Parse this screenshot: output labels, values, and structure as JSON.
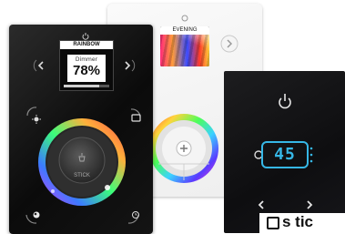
{
  "white_panel": {
    "screen": {
      "scene_label": "EVENING"
    },
    "colors": {
      "panel": "#f2f2f2",
      "wheel_inner": "#dddddd"
    }
  },
  "black_panel": {
    "screen": {
      "scene_label": "RAINBOW",
      "dimmer_label": "Dimmer",
      "dimmer_value": "78%",
      "dimmer_level": 0.78
    },
    "wheel_center_label": "STICK",
    "colors": {
      "panel": "#111111",
      "wheel_ring": "#3a3a3a"
    }
  },
  "dark_panel": {
    "temperature_value": "45",
    "colors": {
      "accent": "#36b7e6"
    }
  },
  "logo": {
    "text": "s tic"
  },
  "icons": [
    "power-icon",
    "arrow-left-icon",
    "arrow-right-icon",
    "sun-icon",
    "scene-icon",
    "plus-icon",
    "chevron-right-icon",
    "clock-icon",
    "knob-icon"
  ]
}
